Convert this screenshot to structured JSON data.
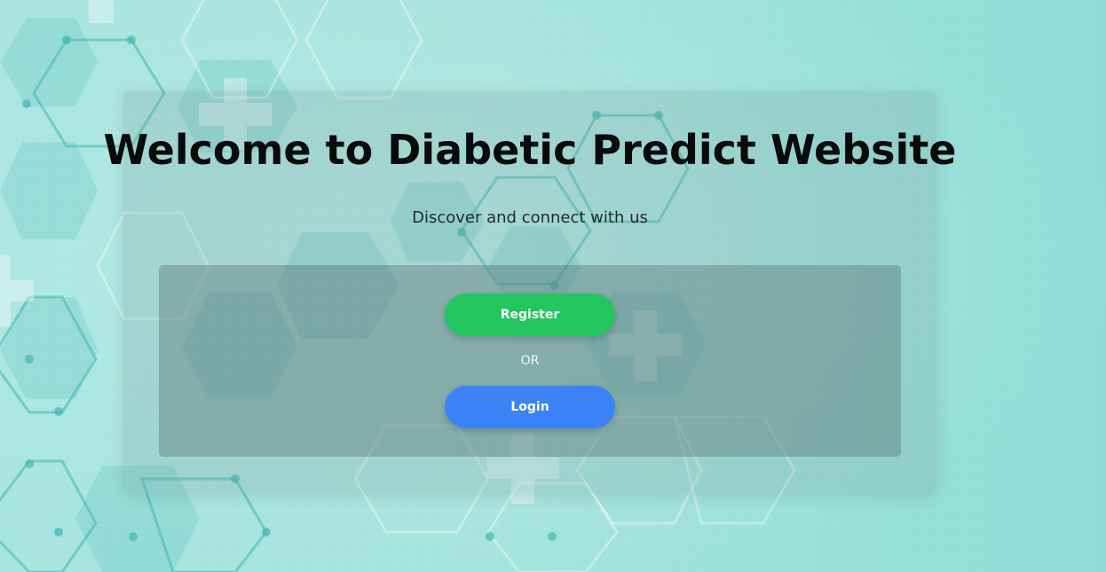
{
  "header": {
    "title": "Welcome to Diabetic Predict Website",
    "subtitle": "Discover and connect with us"
  },
  "actions": {
    "register_label": "Register",
    "separator": "OR",
    "login_label": "Login"
  },
  "colors": {
    "register_button": "#22c55e",
    "login_button": "#3b82f6",
    "background": "#a3e3dc"
  },
  "icons": {
    "background_pattern": "hexagon-medical-cross-pattern"
  }
}
